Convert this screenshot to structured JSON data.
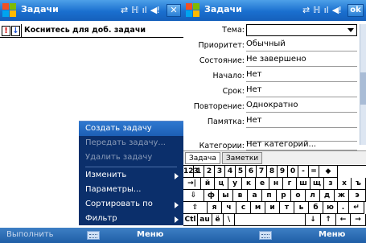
{
  "left": {
    "title": "Задачи",
    "entry_priority_high": "!",
    "entry_priority_low": "↓",
    "entry_text": "Коснитесь для доб. задачи",
    "menu": {
      "items": [
        {
          "label": "Создать задачу",
          "state": "selected"
        },
        {
          "label": "Передать задачу...",
          "state": "disabled"
        },
        {
          "label": "Удалить задачу",
          "state": "disabled"
        },
        {
          "label": "Изменить",
          "submenu": true
        },
        {
          "label": "Параметры...",
          "submenu": false
        },
        {
          "label": "Сортировать по",
          "submenu": true
        },
        {
          "label": "Фильтр",
          "submenu": true
        }
      ]
    },
    "softkey_left": "Выполнить",
    "softkey_right": "Меню"
  },
  "right": {
    "title": "Задачи",
    "ok_label": "ok",
    "fields": {
      "subject_label": "Тема:",
      "priority_label": "Приоритет:",
      "priority_value": "Обычный",
      "status_label": "Состояние:",
      "status_value": "Не завершено",
      "start_label": "Начало:",
      "start_value": "Нет",
      "due_label": "Срок:",
      "due_value": "Нет",
      "recurrence_label": "Повторение:",
      "recurrence_value": "Однократно",
      "reminder_label": "Памятка:",
      "reminder_value": "Нет",
      "categories_label": "Категории:",
      "categories_value": "Нет категорий..."
    },
    "tabs": [
      "Задача",
      "Заметки"
    ],
    "keyboard": {
      "row1": [
        "123",
        "1",
        "2",
        "3",
        "4",
        "5",
        "6",
        "7",
        "8",
        "9",
        "0",
        "-",
        "=",
        "◆"
      ],
      "row2": [
        "→|",
        "й",
        "ц",
        "у",
        "к",
        "е",
        "н",
        "г",
        "ш",
        "щ",
        "з",
        "х",
        "ъ"
      ],
      "row3": [
        "⇩",
        "ф",
        "ы",
        "в",
        "а",
        "п",
        "р",
        "о",
        "л",
        "д",
        "ж",
        "э"
      ],
      "row4": [
        "⇧",
        "я",
        "ч",
        "с",
        "м",
        "и",
        "т",
        "ь",
        "б",
        "ю",
        ".",
        "↵"
      ],
      "row5": [
        "Ctl",
        "аu",
        "ё",
        "\\",
        "",
        "↓",
        "↑",
        "←",
        "→"
      ]
    },
    "softkey_right": "Меню"
  },
  "status_icons": [
    "⇄",
    "ℍ",
    "ıl",
    "◀ǃ"
  ],
  "colors": {
    "titlebar": "#1a6fcf",
    "menu_bg": "#0b2f6b",
    "menu_selected": "#2f78cf",
    "softbar": "#2a69b0"
  }
}
